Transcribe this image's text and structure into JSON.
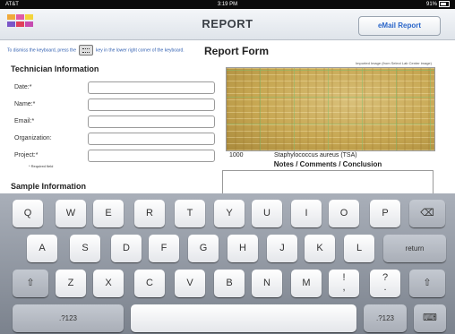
{
  "status_bar": {
    "carrier": "AT&T",
    "time": "3:19 PM",
    "battery": "91%"
  },
  "nav": {
    "title": "REPORT",
    "email_button": "eMail Report"
  },
  "logo_colors": [
    "#f0a93b",
    "#e05aa8",
    "#f3d43b",
    "#7b56c8",
    "#e0405b",
    "#c64bb0"
  ],
  "hint": {
    "before": "To dismiss the keyboard, press the",
    "after": "key in the lower right corner of the keyboard."
  },
  "form_title": "Report Form",
  "image_caption": "Imported Image (from Select Lab Center image)",
  "technician": {
    "title": "Technician Information",
    "fields": [
      {
        "label": "Date:*",
        "value": ""
      },
      {
        "label": "Name:*",
        "value": ""
      },
      {
        "label": "Email:*",
        "value": ""
      },
      {
        "label": "Organization:",
        "value": ""
      },
      {
        "label": "Project:*",
        "value": ""
      }
    ],
    "required_note": "* Required field"
  },
  "sample_title": "Sample Information",
  "plate": {
    "dilution": "1000",
    "organism": "Staphylococcus aureus (TSA)"
  },
  "notes_title": "Notes / Comments / Conclusion",
  "keyboard": {
    "row1": [
      "Q",
      "W",
      "E",
      "R",
      "T",
      "Y",
      "U",
      "I",
      "O",
      "P"
    ],
    "backspace": "⌫",
    "row2": [
      "A",
      "S",
      "D",
      "F",
      "G",
      "H",
      "J",
      "K",
      "L"
    ],
    "return": "return",
    "shift": "⇧",
    "row3": [
      "Z",
      "X",
      "C",
      "V",
      "B",
      "N",
      "M",
      "!\n,",
      "?\n."
    ],
    "numbers": ".?123",
    "dismiss": "⌨"
  }
}
